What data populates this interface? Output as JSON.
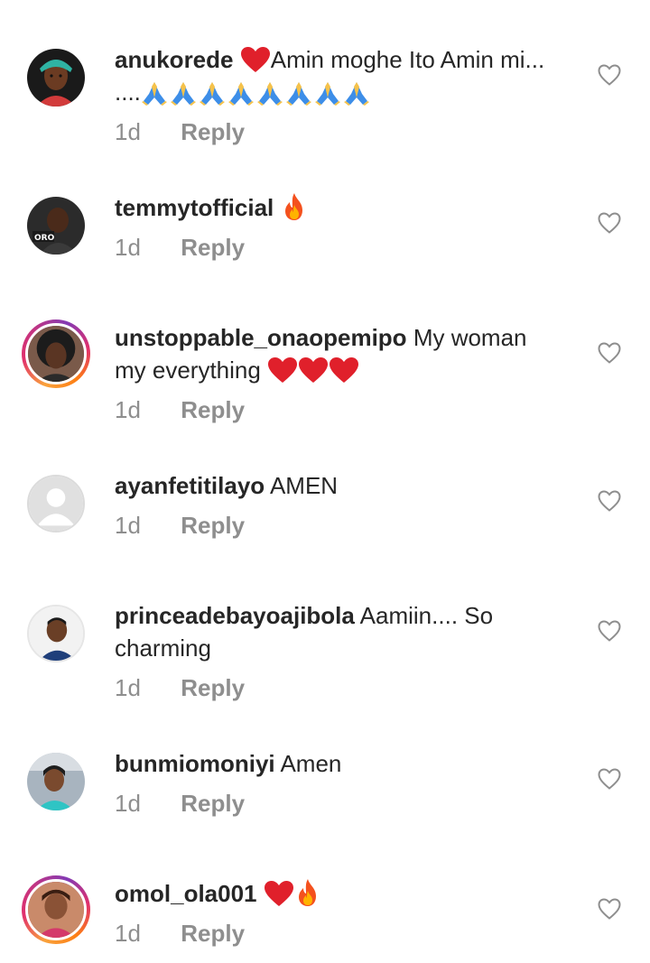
{
  "comments": [
    {
      "username": "anukorede",
      "text_after": "Amin moghe Ito Amin mi...",
      "line2_prefix": "....",
      "time": "1d",
      "reply_label": "Reply",
      "avatar_icon": "avatar-photo-woman-headwrap"
    },
    {
      "username": "temmytofficial",
      "time": "1d",
      "reply_label": "Reply",
      "avatar_icon": "avatar-photo-man-logo"
    },
    {
      "username": "unstoppable_onaopemipo",
      "text": "My woman",
      "line2": "my everything",
      "time": "1d",
      "reply_label": "Reply",
      "avatar_icon": "avatar-photo-woman-story-ring"
    },
    {
      "username": "ayanfetitilayo",
      "text": "AMEN",
      "time": "1d",
      "reply_label": "Reply",
      "avatar_icon": "default-avatar-icon"
    },
    {
      "username": "princeadebayoajibola",
      "text": "Aamiin.... So",
      "line2": "charming",
      "time": "1d",
      "reply_label": "Reply",
      "avatar_icon": "avatar-photo-man"
    },
    {
      "username": "bunmiomoniyi",
      "text": "Amen",
      "time": "1d",
      "reply_label": "Reply",
      "avatar_icon": "avatar-photo-woman-car"
    },
    {
      "username": "omol_ola001",
      "time": "1d",
      "reply_label": "Reply",
      "avatar_icon": "avatar-photo-woman-story-ring"
    }
  ],
  "colors": {
    "text": "#262626",
    "secondary": "#8e8e8e",
    "heart_red": "#ed4956",
    "story_ring": "#e1306c"
  }
}
